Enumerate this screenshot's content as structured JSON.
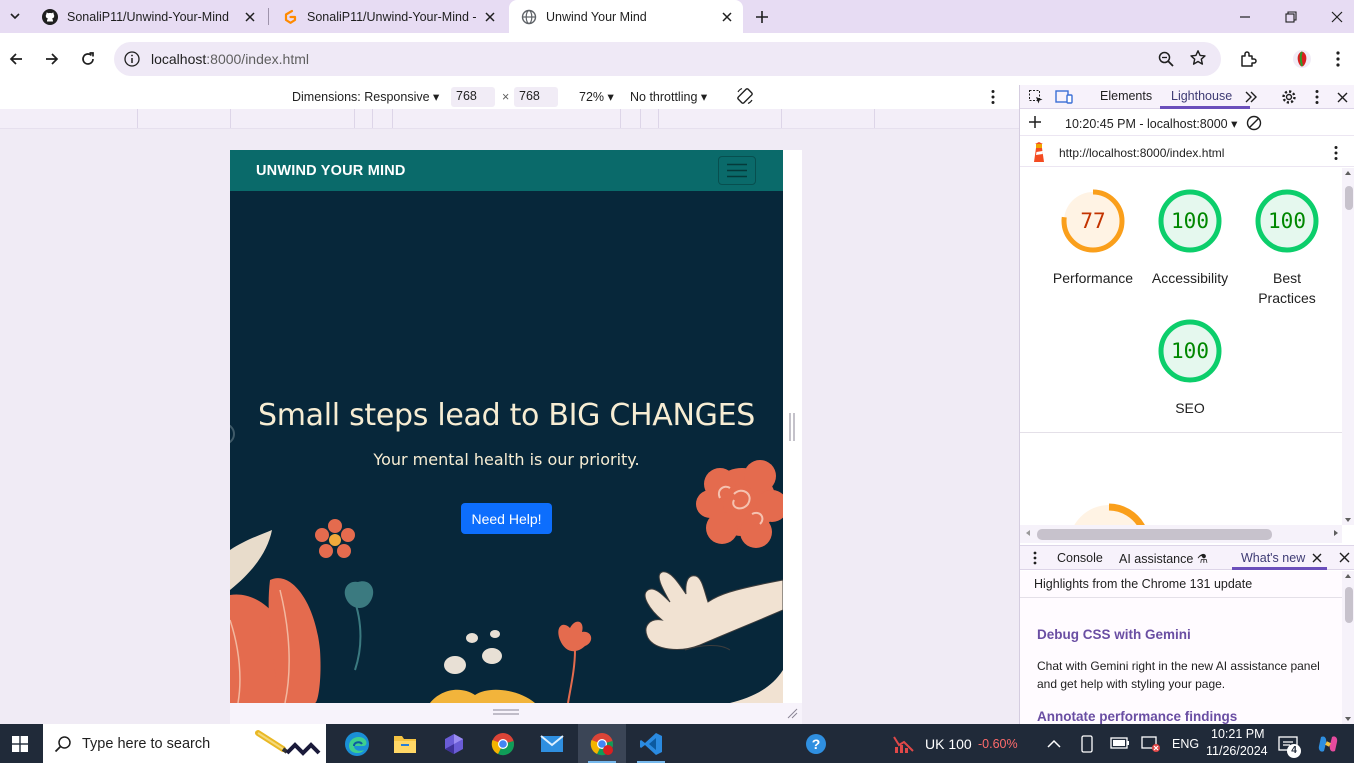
{
  "browser": {
    "tabs": [
      {
        "title": "SonaliP11/Unwind-Your-Mind",
        "icon": "github-icon",
        "active": false
      },
      {
        "title": "SonaliP11/Unwind-Your-Mind - ",
        "icon": "gitpod-icon",
        "active": false
      },
      {
        "title": "Unwind Your Mind",
        "icon": "globe-icon",
        "active": true
      }
    ],
    "url": {
      "host": "localhost",
      "path": ":8000/index.html"
    }
  },
  "device_toolbar": {
    "dimensions_label": "Dimensions: Responsive",
    "width": "768",
    "height": "768",
    "times": "×",
    "zoom": "72%",
    "throttling": "No throttling"
  },
  "site": {
    "brand": "UNWIND YOUR MIND",
    "hero_title": "Small steps lead to BIG CHANGES",
    "hero_subtitle": "Your mental health is our priority.",
    "cta_label": "Need Help!"
  },
  "devtools": {
    "tabs": {
      "elements": "Elements",
      "lighthouse": "Lighthouse"
    },
    "report_selector": "10:20:45 PM - localhost:8000",
    "report_url": "http://localhost:8000/index.html",
    "scores": [
      {
        "label": "Performance",
        "value": "77",
        "value_num": 77,
        "color": "#fa9f1b"
      },
      {
        "label": "Accessibility",
        "value": "100",
        "value_num": 100,
        "color": "#0cce6b"
      },
      {
        "label": "Best Practices",
        "value": "100",
        "value_num": 100,
        "color": "#0cce6b"
      },
      {
        "label": "SEO",
        "value": "100",
        "value_num": 100,
        "color": "#0cce6b"
      }
    ],
    "drawer_tabs": {
      "console": "Console",
      "ai": "AI assistance",
      "whats_new": "What's new"
    },
    "whats_new": {
      "heading": "Highlights from the Chrome 131 update",
      "item1_title": "Debug CSS with Gemini",
      "item1_text": "Chat with Gemini right in the new AI assistance panel and get help with styling your page.",
      "item2_title": "Annotate performance findings"
    }
  },
  "taskbar": {
    "search_placeholder": "Type here to search",
    "stock_name": "UK 100",
    "stock_change": "-0.60%",
    "language": "ENG",
    "time": "10:21 PM",
    "date": "11/26/2024",
    "notifications": "4"
  },
  "colors": {
    "nav_teal": "#0a6a6a",
    "hero_bg": "#07273a",
    "cta_blue": "#0d6efd",
    "tabstrip": "#e7dcf3",
    "stock_negative": "#ff6b6b"
  }
}
